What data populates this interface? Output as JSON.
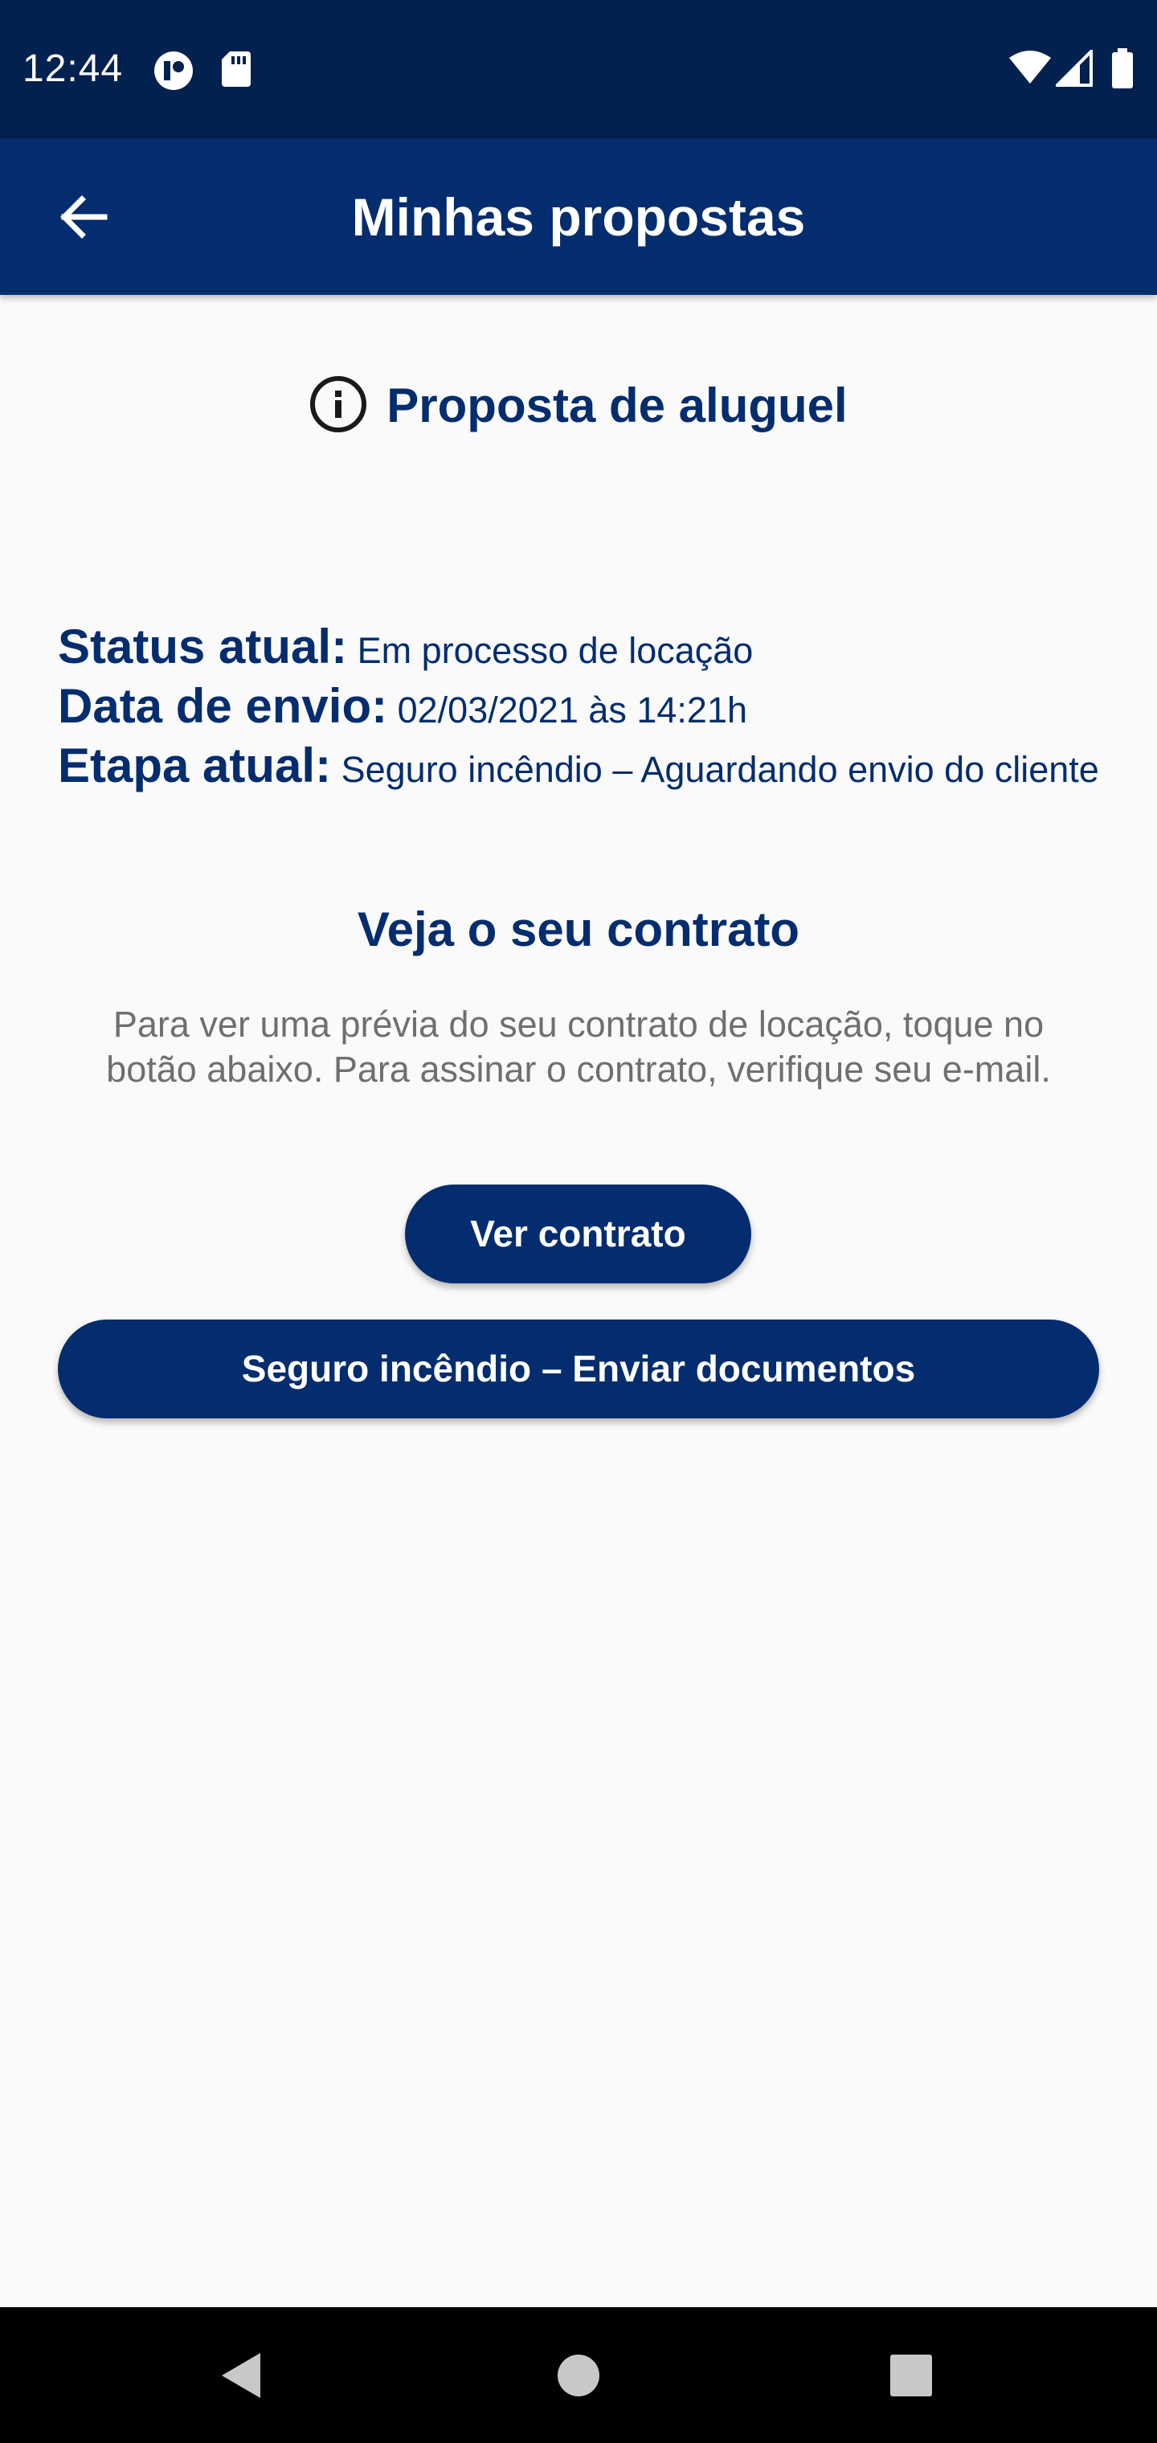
{
  "status_bar": {
    "time": "12:44",
    "icons": [
      "app-notification-icon",
      "sd-card-icon",
      "wifi-icon",
      "cell-signal-icon",
      "battery-icon"
    ]
  },
  "app_bar": {
    "title": "Minhas propostas",
    "back_icon": "arrow-back-icon"
  },
  "proposal": {
    "heading": "Proposta de aluguel",
    "heading_icon": "info-icon",
    "status_label": "Status atual:",
    "status_value": "Em processo de locação",
    "date_label": "Data de envio:",
    "date_value": "02/03/2021 às 14:21h",
    "step_label": "Etapa atual:",
    "step_value": "Seguro incêndio – Aguardando envio do cliente"
  },
  "contract": {
    "title": "Veja o seu contrato",
    "description": "Para ver uma prévia do seu contrato de locação, toque no botão abaixo. Para assinar o contrato, verifique seu e-mail.",
    "view_button": "Ver contrato",
    "documents_button": "Seguro incêndio – Enviar documentos"
  },
  "nav_bar": {
    "icons": [
      "nav-back-icon",
      "nav-home-icon",
      "nav-recents-icon"
    ]
  },
  "colors": {
    "status_bar": "#03214f",
    "primary": "#032d6e",
    "background": "#fafafa",
    "muted_text": "#6f6f6f"
  }
}
